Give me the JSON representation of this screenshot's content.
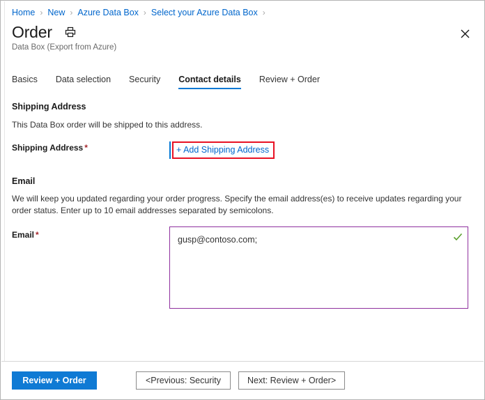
{
  "breadcrumb": {
    "items": [
      {
        "label": "Home"
      },
      {
        "label": "New"
      },
      {
        "label": "Azure Data Box"
      },
      {
        "label": "Select your Azure Data Box"
      }
    ],
    "separator": "›"
  },
  "header": {
    "title": "Order",
    "subtitle": "Data Box (Export from Azure)",
    "print_icon": "print-icon",
    "close_icon": "close-icon"
  },
  "tabs": [
    {
      "label": "Basics",
      "active": false
    },
    {
      "label": "Data selection",
      "active": false
    },
    {
      "label": "Security",
      "active": false
    },
    {
      "label": "Contact details",
      "active": true
    },
    {
      "label": "Review + Order",
      "active": false
    }
  ],
  "shipping": {
    "section_title": "Shipping Address",
    "description": "This Data Box order will be shipped to this address.",
    "field_label": "Shipping Address",
    "required_mark": "*",
    "add_link": "+ Add Shipping Address",
    "highlight_color": "#e81123",
    "accent_color": "#0078d4"
  },
  "email": {
    "section_title": "Email",
    "description": "We will keep you updated regarding your order progress. Specify the email address(es) to receive updates regarding your order status. Enter up to 10 email addresses separated by semicolons.",
    "field_label": "Email",
    "required_mark": "*",
    "value": "gusp@contoso.com;",
    "placeholder": "",
    "valid_icon": "checkmark-icon",
    "valid_color": "#5aa02c",
    "border_color": "#8e2f9e"
  },
  "footer": {
    "primary_button": "Review + Order",
    "previous_button": "<Previous: Security",
    "next_button": "Next: Review + Order>",
    "primary_color": "#0f7ad4"
  }
}
